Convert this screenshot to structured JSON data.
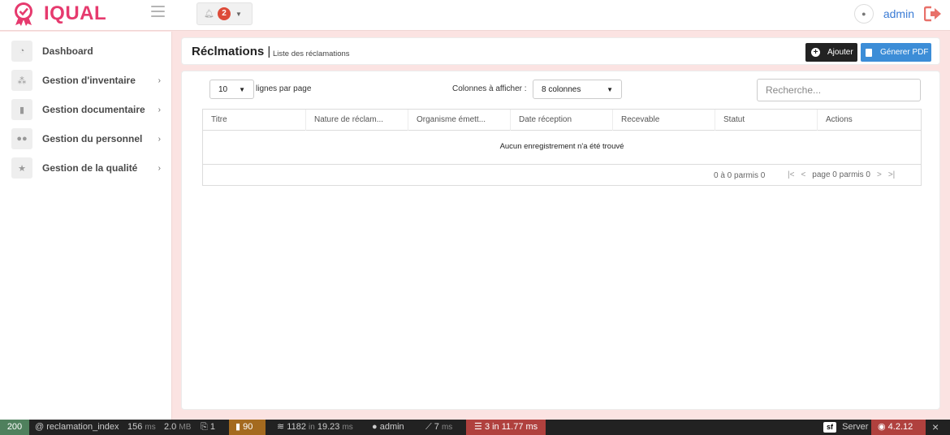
{
  "brand": {
    "name": "IQUAL",
    "color": "#e63a6e"
  },
  "header": {
    "notifications_count": "2",
    "user_name": "admin"
  },
  "sidebar": {
    "items": [
      {
        "label": "Dashboard",
        "icon": "dashboard-icon",
        "has_children": false
      },
      {
        "label": "Gestion d'inventaire",
        "icon": "cubes-icon",
        "has_children": true
      },
      {
        "label": "Gestion documentaire",
        "icon": "file-icon",
        "has_children": true
      },
      {
        "label": "Gestion du personnel",
        "icon": "users-icon",
        "has_children": true
      },
      {
        "label": "Gestion de la qualité",
        "icon": "star-icon",
        "has_children": true
      }
    ]
  },
  "page": {
    "title": "Réclmations",
    "separator": "|",
    "subtitle": "Liste des réclamations",
    "add_label": "Ajouter",
    "pdf_label": "Génerer PDF"
  },
  "table_controls": {
    "page_length": "10",
    "page_length_label": "lignes par page",
    "columns_label": "Colonnes à afficher :",
    "columns_value": "8 colonnes",
    "search_placeholder": "Recherche..."
  },
  "table": {
    "columns": [
      "Titre",
      "Nature de réclam...",
      "Organisme émett...",
      "Date réception",
      "Recevable",
      "Statut",
      "Actions"
    ],
    "empty_message": "Aucun enregistrement n'a été trouvé",
    "count_info": "0 à 0 parmis 0",
    "first": "|<",
    "prev": "<",
    "page_info": "page 0 parmis 0",
    "next": ">",
    "last": ">|"
  },
  "debug_toolbar": {
    "status_code": "200",
    "route": "@ reclamation_index",
    "time_value": "156",
    "time_unit": "ms",
    "memory_value": "2.0",
    "memory_unit": "MB",
    "forms_count": "1",
    "warnings_count": "90",
    "cache_text": "1182",
    "cache_mid": "in",
    "cache_time": "19.23",
    "cache_unit": "ms",
    "user": "admin",
    "twig_value": "7",
    "twig_unit": "ms",
    "db_text": "3 in 11.77 ms",
    "server_label": "Server",
    "version": "4.2.12",
    "close_label": "×",
    "colors": {
      "status": "#4f805d",
      "warn": "#a46a1f",
      "error": "#b0413e"
    }
  }
}
